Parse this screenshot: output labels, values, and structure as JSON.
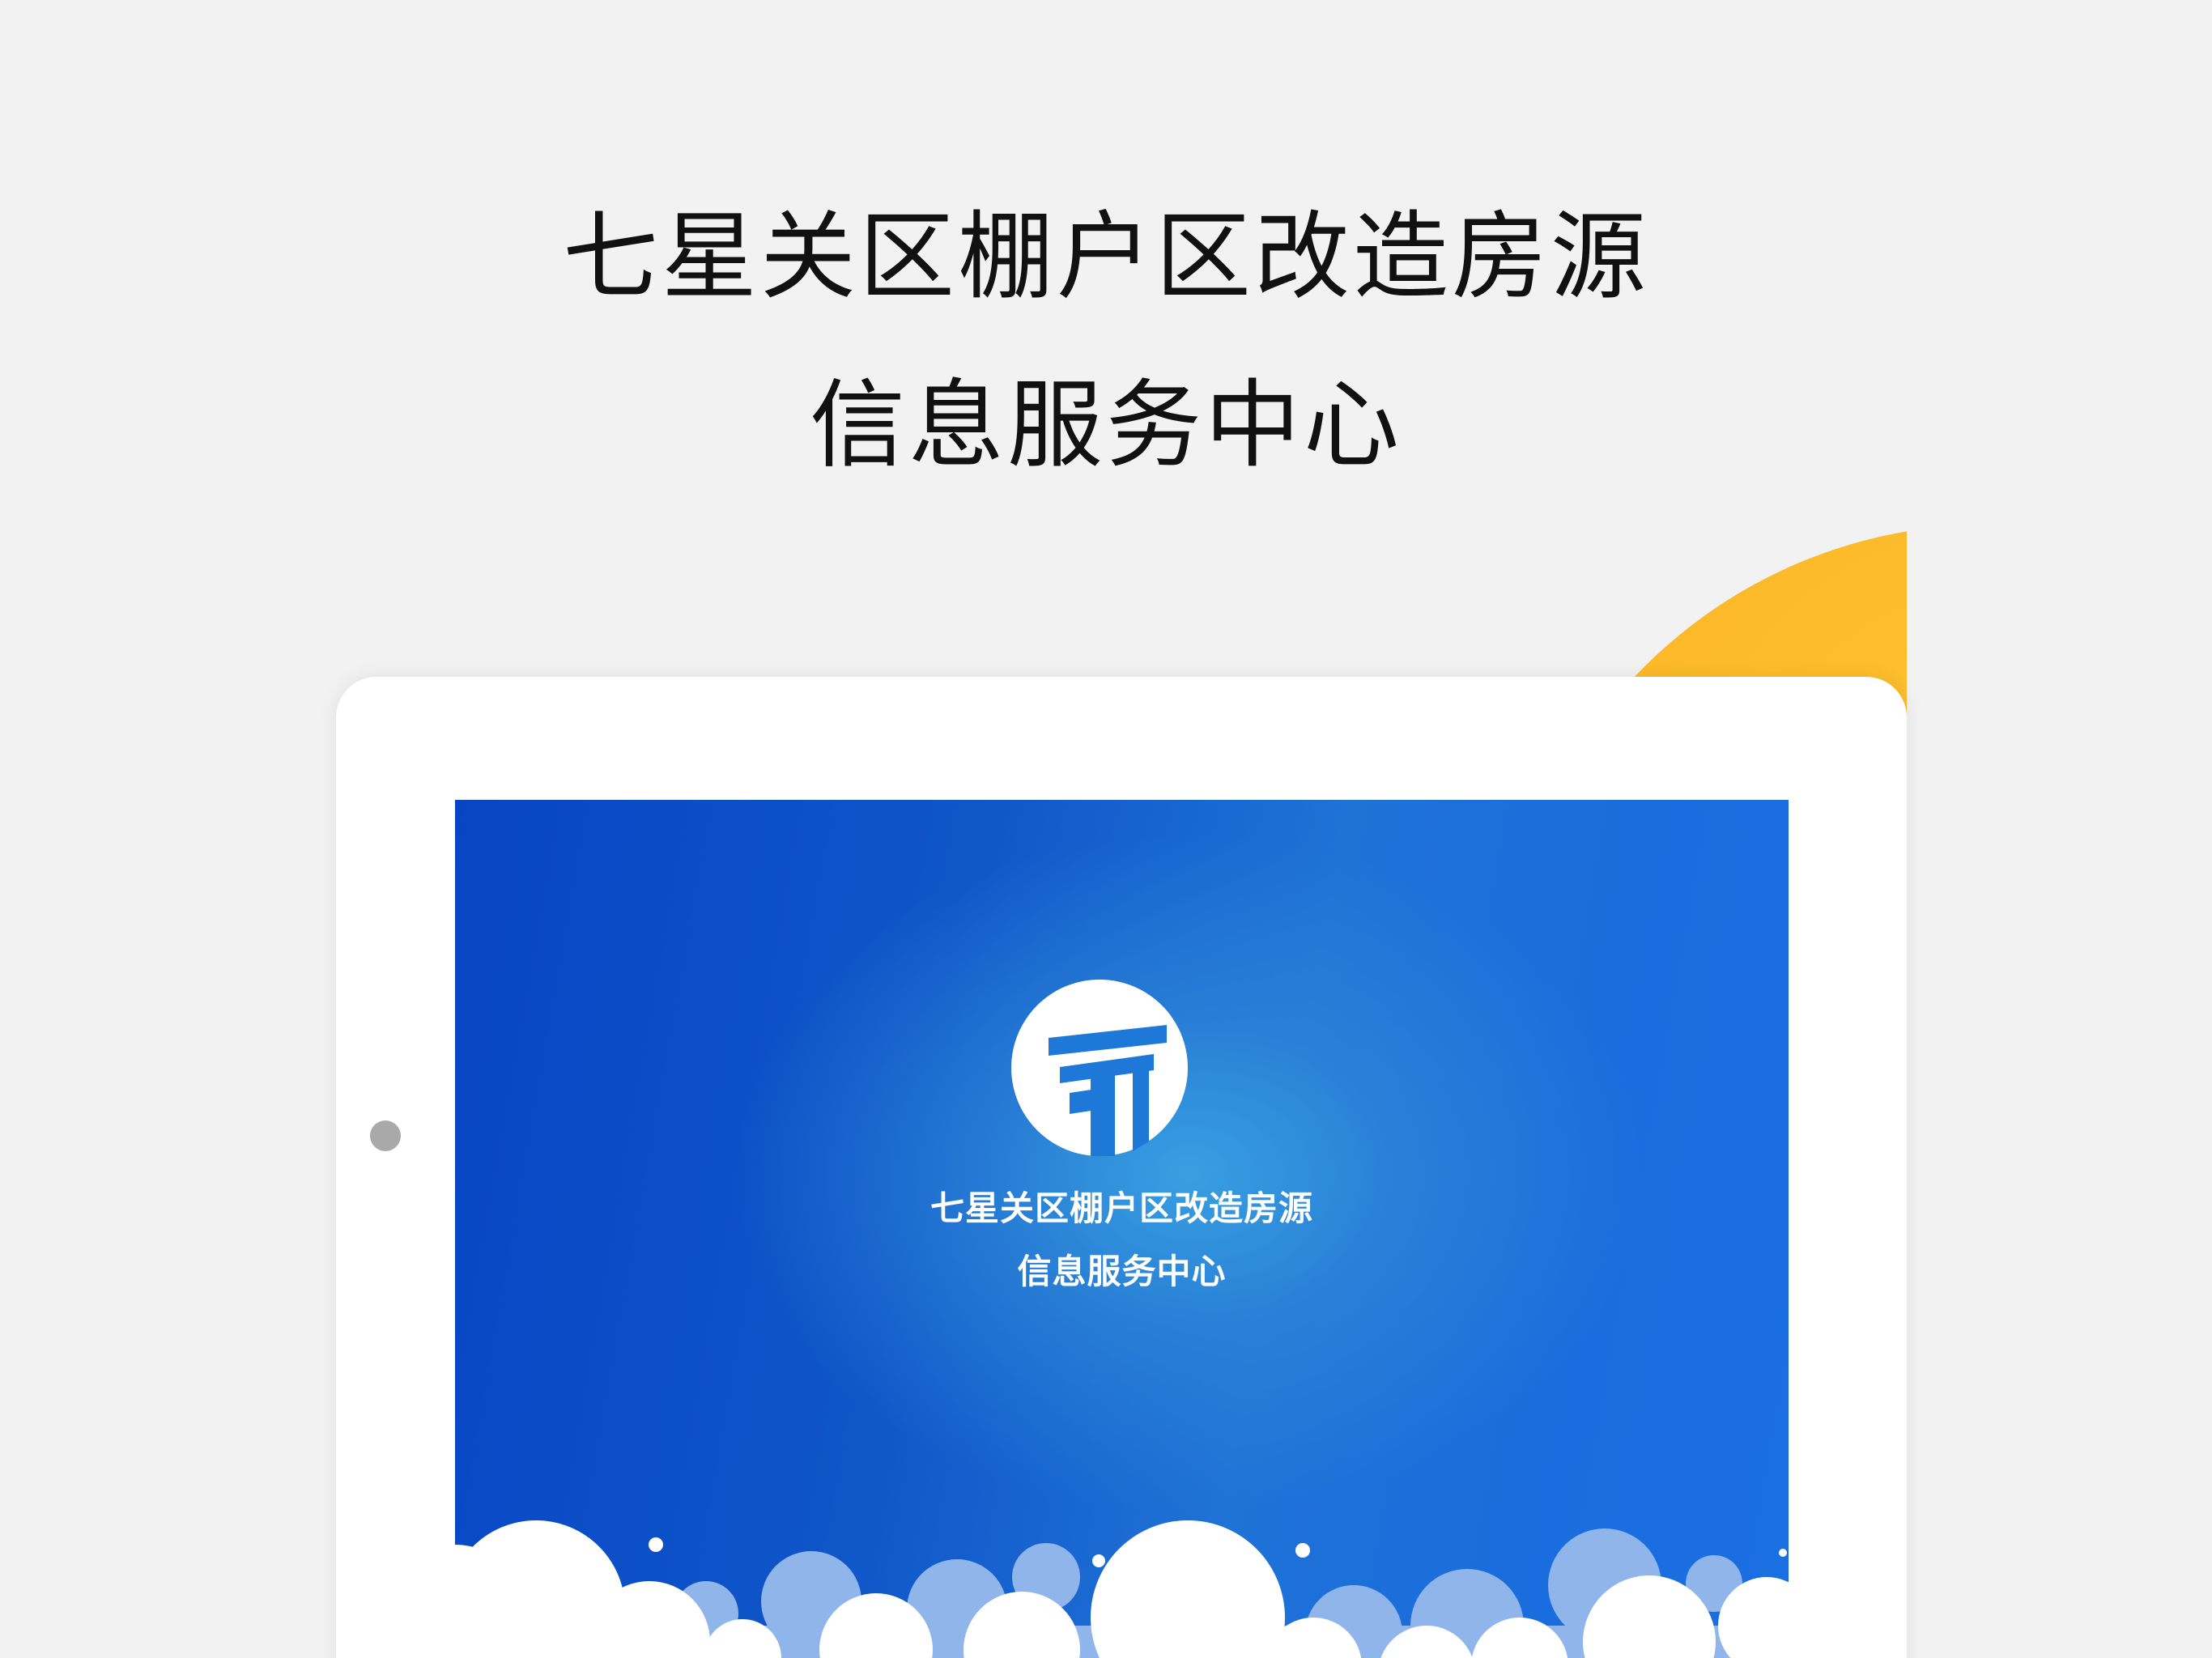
{
  "promo": {
    "title_line1": "七星关区棚户区改造房源",
    "title_line2": "信息服务中心"
  },
  "splash": {
    "app_title_line1": "七星关区棚户区改造房源",
    "app_title_line2": "信息服务中心",
    "logo_icon": "white-circle-t-logo-icon"
  },
  "colors": {
    "background": "#f2f2f2",
    "sun": "#fbb829",
    "screen_blue": "#0f56c9",
    "tablet_frame": "#ffffff"
  }
}
